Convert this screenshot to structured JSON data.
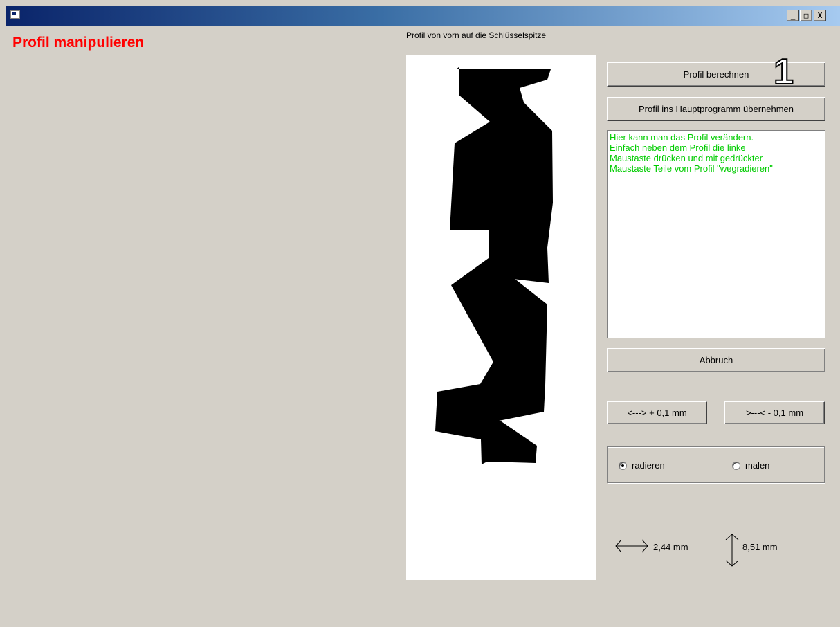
{
  "window": {
    "title": "",
    "controls": {
      "minimize_label": "_",
      "maximize_label": "□",
      "close_label": "X"
    }
  },
  "page_title": "Profil manipulieren",
  "profile_caption": "Profil von vorn auf die Schlüsselspitze",
  "buttons": {
    "calculate": "Profil berechnen",
    "apply": "Profil ins Hauptprogramm übernehmen",
    "cancel": "Abbruch",
    "widen": "<---> + 0,1 mm",
    "narrow": ">---< - 0,1 mm"
  },
  "step_marker": "1",
  "info_text": "Hier kann man das Profil verändern.\nEinfach neben dem Profil die linke\nMaustaste drücken und mit gedrückter\nMaustaste Teile vom Profil \"wegradieren\"",
  "mode": {
    "options": [
      {
        "label": "radieren",
        "checked": true
      },
      {
        "label": "malen",
        "checked": false
      }
    ]
  },
  "dimensions": {
    "width": "2,44 mm",
    "height": "8,51 mm"
  },
  "colors": {
    "title_red": "#ff0000",
    "info_green": "#00cc00",
    "dialog_gray": "#d4d0c8",
    "profile_black": "#000000"
  }
}
